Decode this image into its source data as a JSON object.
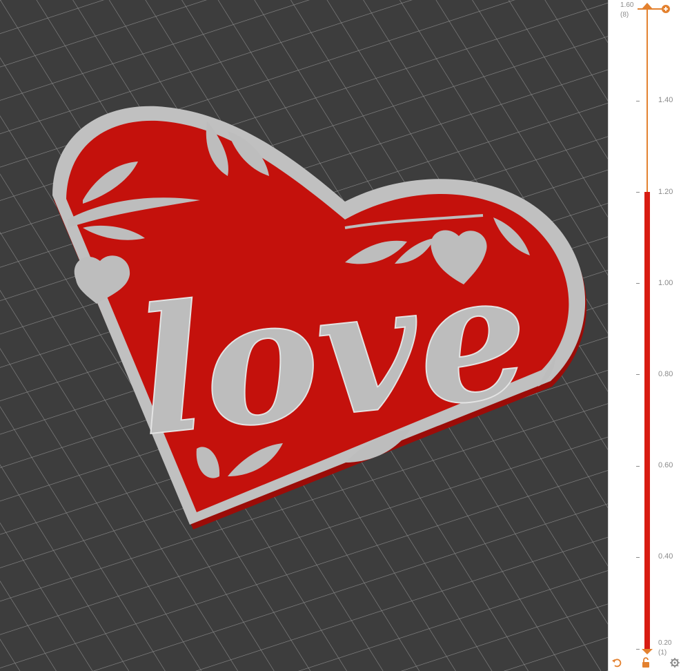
{
  "viewport": {
    "model": "3D print preview - heart plate",
    "text_on_model": "love",
    "colors": {
      "background": "#3d3d3d",
      "grid": "#8d8d8d",
      "plate": "#c4110c",
      "raised": "#bdbdbd"
    }
  },
  "layer_slider": {
    "top_value": "1.60",
    "top_layer": "(8)",
    "bottom_value": "0.20",
    "bottom_layer": "(1)",
    "ticks": [
      "1.40",
      "1.20",
      "1.00",
      "0.80",
      "0.60",
      "0.40"
    ],
    "upper_handle_value": 1.6,
    "lower_handle_value": 0.2,
    "colors": {
      "rail": "#e3812f",
      "range": "#d81c12",
      "label": "#8a8a8a"
    }
  },
  "icons": {
    "upper_handle_button": "cog-plus-icon",
    "reset": "undo-icon",
    "lock": "lock-icon",
    "settings": "gear-icon"
  }
}
